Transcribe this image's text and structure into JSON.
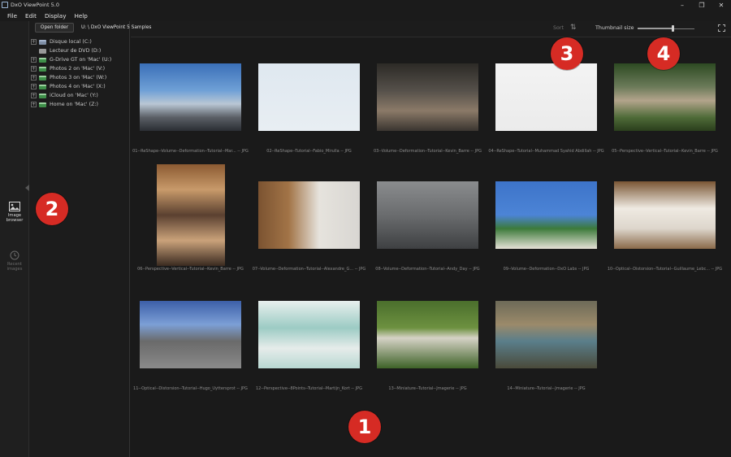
{
  "window": {
    "title": "DxO ViewPoint 5.0",
    "controls": [
      "–",
      "❐",
      "✕"
    ]
  },
  "menu": [
    "File",
    "Edit",
    "Display",
    "Help"
  ],
  "rail": {
    "image_browser": "Image browser",
    "recent_images": "Recent images"
  },
  "tree": {
    "open_folder": "Open folder",
    "items": [
      {
        "label": "Disque local (C:)",
        "type": "local",
        "expand": "+"
      },
      {
        "label": "Lecteur de DVD (D:)",
        "type": "dvd",
        "expand": ""
      },
      {
        "label": "G-Drive GT on 'Mac' (U:)",
        "type": "net",
        "expand": "+"
      },
      {
        "label": "Photos 2 on 'Mac' (V:)",
        "type": "net",
        "expand": "+"
      },
      {
        "label": "Photos 3 on 'Mac' (W:)",
        "type": "net",
        "expand": "+"
      },
      {
        "label": "Photos 4 on 'Mac' (X:)",
        "type": "net",
        "expand": "+"
      },
      {
        "label": "iCloud on 'Mac' (Y:)",
        "type": "net",
        "expand": "+"
      },
      {
        "label": "Home on 'Mac' (Z:)",
        "type": "net",
        "expand": "+"
      }
    ]
  },
  "toolbar": {
    "path": "U: \\ DxO ViewPoint 5 Samples",
    "sort_label": "Sort",
    "sort_icon": "⇅",
    "thumb_size_label": "Thumbnail size",
    "thumb_size_level": 0.62
  },
  "thumbnails": [
    {
      "caption": "01--ReShape--Volume--Deformation--Tutorial--Mar... -- JPG",
      "bg": "linear-gradient(180deg,#3a6fb8 0%,#6fa0d6 40%,#b9c7d4 60%,#5b5f66 80%,#2a2d33 100%)"
    },
    {
      "caption": "02--ReShape--Tutorial--Fabio_Mirulla -- JPG",
      "bg": "linear-gradient(180deg,#dfe8f0 0%,#e8eef3 100%)"
    },
    {
      "caption": "03--Volume--Deformation--Tutorial--Kevin_Barre -- JPG",
      "bg": "linear-gradient(180deg,#2c2a26 0%,#55504a 40%,#8b7a68 70%,#3a3530 100%)"
    },
    {
      "caption": "04--ReShape--Tutorial--Muhammad Syahid Abdillah -- JPG",
      "bg": "linear-gradient(180deg,#f3f3f3 0%,#ebebeb 100%)"
    },
    {
      "caption": "05--Perspective--Vertical--Tutorial--Kevin_Barre -- JPG",
      "bg": "linear-gradient(180deg,#2d4a22 0%,#6c7b5a 35%,#b3a48c 55%,#4f6b38 80%,#2a3e1c 100%)"
    },
    {
      "caption": "06--Perspective--Vertical--Tutorial--Kevin_Barre -- JPG",
      "bg": "linear-gradient(180deg,#8b5a32 0%,#c89a6a 25%,#5a4030 50%,#caa27a 75%,#3a2a20 100%)"
    },
    {
      "caption": "07--Volume--Deformation--Tutorial--Alexandre_G... -- JPG",
      "bg": "linear-gradient(90deg,#7b5331 0%,#a27447 30%,#e6e3dd 60%,#d8d6d2 100%)"
    },
    {
      "caption": "08--Volume--Deformation--Tutorial--Andy_Day -- JPG",
      "bg": "linear-gradient(180deg,#8a8c8e 0%,#6a6c6e 50%,#3e4042 100%)"
    },
    {
      "caption": "09--Volume--Deformation--DxO Labs -- JPG",
      "bg": "linear-gradient(180deg,#3d74c9 0%,#4c84d6 50%,#3c7a3a 70%,#e5e0d6 100%)"
    },
    {
      "caption": "10--Optical--Distorsion--Tutorial--Guillaume_Lebc... -- JPG",
      "bg": "linear-gradient(180deg,#7a5634 0%,#efeae2 40%,#ddd6cc 70%,#8a6a4a 100%)"
    },
    {
      "caption": "11--Optical--Distorsion--Tutorial--Hugo_Uyttersprot -- JPG",
      "bg": "linear-gradient(180deg,#3c5fa8 0%,#7c9fd6 35%,#6a6a6a 60%,#8a8a8a 100%)"
    },
    {
      "caption": "12--Perspective--8Points--Tutorial--Martijn_Kort -- JPG",
      "bg": "linear-gradient(180deg,#e8f0ee 0%,#9ccbc4 40%,#e6ecea 70%,#b8d8d2 100%)"
    },
    {
      "caption": "13--Miniature--Tutorial--Jmagerie -- JPG",
      "bg": "linear-gradient(180deg,#4a6e2c 0%,#6d9140 40%,#d6d2c6 55%,#3e6228 100%)"
    },
    {
      "caption": "14--Miniature--Tutorial--Jmagerie -- JPG",
      "bg": "linear-gradient(180deg,#6d6a58 0%,#9b8a6a 35%,#5a7e8a 60%,#4a4a3a 100%)"
    }
  ],
  "badges": [
    "1",
    "2",
    "3",
    "4"
  ],
  "colors": {
    "badge_red": "#d62b24",
    "background": "#1a1a1a"
  }
}
